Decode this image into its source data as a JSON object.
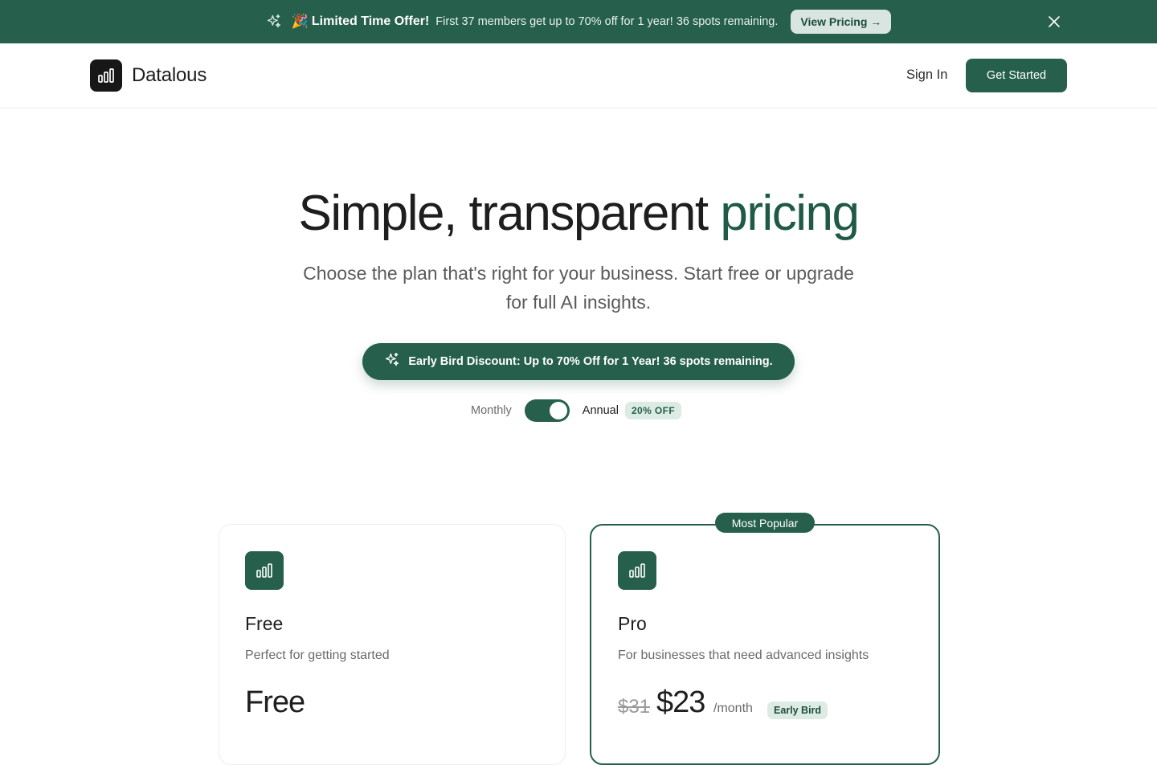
{
  "promo": {
    "icon": "sparkles-icon",
    "emoji": "🎉",
    "title": "Limited Time Offer!",
    "text": "First 37 members get up to 70% off for 1 year! 36 spots remaining.",
    "button_label": "View Pricing →",
    "close_icon": "close-icon",
    "background": "#26604c"
  },
  "header": {
    "logo_text": "Datalous",
    "logo_icon": "bar-chart-icon",
    "signin_label": "Sign In",
    "get_started_label": "Get Started"
  },
  "hero": {
    "title_main": "Simple, transparent ",
    "title_accent": "pricing",
    "subtitle": "Choose the plan that's right for your business. Start free or upgrade for full AI insights.",
    "discount_text": "Early Bird Discount: Up to 70% Off for 1 Year! 36 spots remaining.",
    "discount_icon": "sparkles-icon"
  },
  "billing": {
    "monthly_label": "Monthly",
    "annual_label": "Annual",
    "annual_selected": true,
    "off_badge": "20% OFF"
  },
  "plans": [
    {
      "name": "Free",
      "description": "Perfect for getting started",
      "price": "Free",
      "icon": "bar-chart-icon"
    },
    {
      "name": "Pro",
      "badge": "Most Popular",
      "description": "For businesses that need advanced insights",
      "old_price": "$31",
      "price": "$23",
      "per": "/month",
      "tag": "Early Bird",
      "icon": "bar-chart-icon"
    }
  ],
  "colors": {
    "brand": "#26604c",
    "brand_light": "#dcebe4",
    "text": "#1e1e1e",
    "muted": "#6a6a6a"
  }
}
